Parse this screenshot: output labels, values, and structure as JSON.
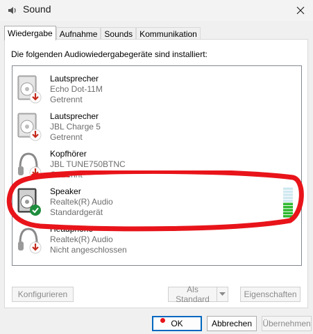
{
  "window": {
    "title": "Sound",
    "icon": "speaker-icon",
    "close_icon": "close-icon"
  },
  "tabs": [
    {
      "label": "Wiedergabe",
      "active": true
    },
    {
      "label": "Aufnahme",
      "active": false
    },
    {
      "label": "Sounds",
      "active": false
    },
    {
      "label": "Kommunikation",
      "active": false
    }
  ],
  "panel": {
    "intro": "Die folgenden Audiowiedergabegeräte sind installiert:"
  },
  "devices": [
    {
      "name": "Lautsprecher",
      "model": "Echo Dot-11M",
      "status": "Getrennt",
      "icon": "speaker-box-icon",
      "badge": "disconnected-arrow-icon"
    },
    {
      "name": "Lautsprecher",
      "model": "JBL Charge 5",
      "status": "Getrennt",
      "icon": "speaker-box-icon",
      "badge": "disconnected-arrow-icon"
    },
    {
      "name": "Kopfhörer",
      "model": "JBL TUNE750BTNC",
      "status": "Getrennt",
      "icon": "headphones-icon",
      "badge": "disconnected-arrow-icon"
    },
    {
      "name": "Speaker",
      "model": "Realtek(R) Audio",
      "status": "Standardgerät",
      "icon": "speaker-box-icon",
      "badge": "default-check-icon"
    },
    {
      "name": "Headphone",
      "model": "Realtek(R) Audio",
      "status": "Nicht angeschlossen",
      "icon": "headphones-icon",
      "badge": "disconnected-arrow-icon"
    }
  ],
  "level_meter": {
    "level": 0.45,
    "active_color": "#2db82d",
    "idle_color": "#cfe8f0"
  },
  "buttons": {
    "configure": "Konfigurieren",
    "set_default": "Als Standard",
    "properties": "Eigenschaften",
    "ok": "OK",
    "cancel": "Abbrechen",
    "apply": "Übernehmen"
  },
  "colors": {
    "accent": "#0067c0",
    "highlight_ring": "#e8141a",
    "check": "#1e8e3e",
    "disconnect": "#c42b1c"
  }
}
